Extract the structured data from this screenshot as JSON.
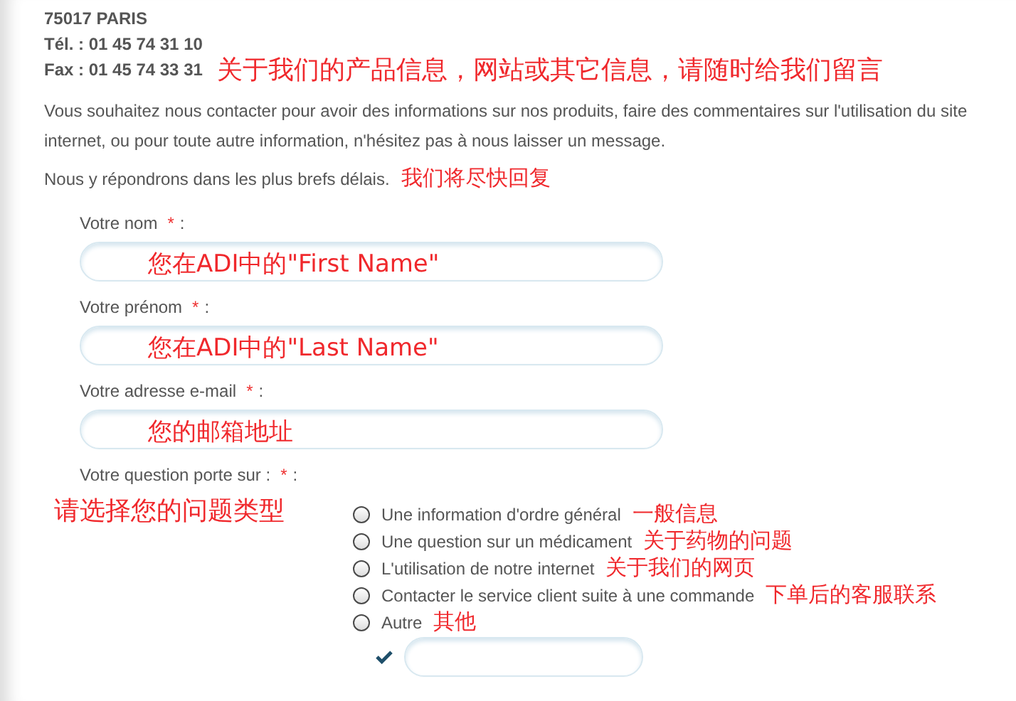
{
  "address": {
    "city": "75017 PARIS",
    "phone": "Tél. : 01 45 74 31 10",
    "fax": "Fax : 01 45 74 33 31",
    "note": "关于我们的产品信息，网站或其它信息，请随时给我们留言"
  },
  "intro": {
    "text": "Vous souhaitez nous contacter pour avoir des informations sur nos produits, faire des commentaires sur l'utilisation du site internet, ou pour toute autre information, n'hésitez pas à nous laisser un message.",
    "reply": "Nous y répondrons dans les plus brefs délais.",
    "reply_note": "我们将尽快回复"
  },
  "fields": [
    {
      "label": "Votre nom",
      "required_mark": "*",
      "separator": ":",
      "note": "您在ADI中的\"First Name\""
    },
    {
      "label": "Votre prénom",
      "required_mark": "*",
      "separator": ":",
      "note": "您在ADI中的\"Last Name\""
    },
    {
      "label": "Votre adresse e-mail",
      "required_mark": "*",
      "separator": ":",
      "note": "您的邮箱地址"
    }
  ],
  "question": {
    "label": "Votre question porte sur :",
    "required_mark": "*",
    "separator": ":",
    "note": "请选择您的问题类型",
    "options": [
      {
        "label": "Une information d'ordre général",
        "note": "一般信息",
        "selected": false
      },
      {
        "label": "Une question sur un médicament",
        "note": "关于药物的问题",
        "selected": false
      },
      {
        "label": "L'utilisation de notre internet",
        "note": "关于我们的网页",
        "selected": false
      },
      {
        "label": "Contacter le service client suite à une commande",
        "note": "下单后的客服联系",
        "selected": false
      },
      {
        "label": "Autre",
        "note": "其他",
        "selected": false
      }
    ]
  }
}
